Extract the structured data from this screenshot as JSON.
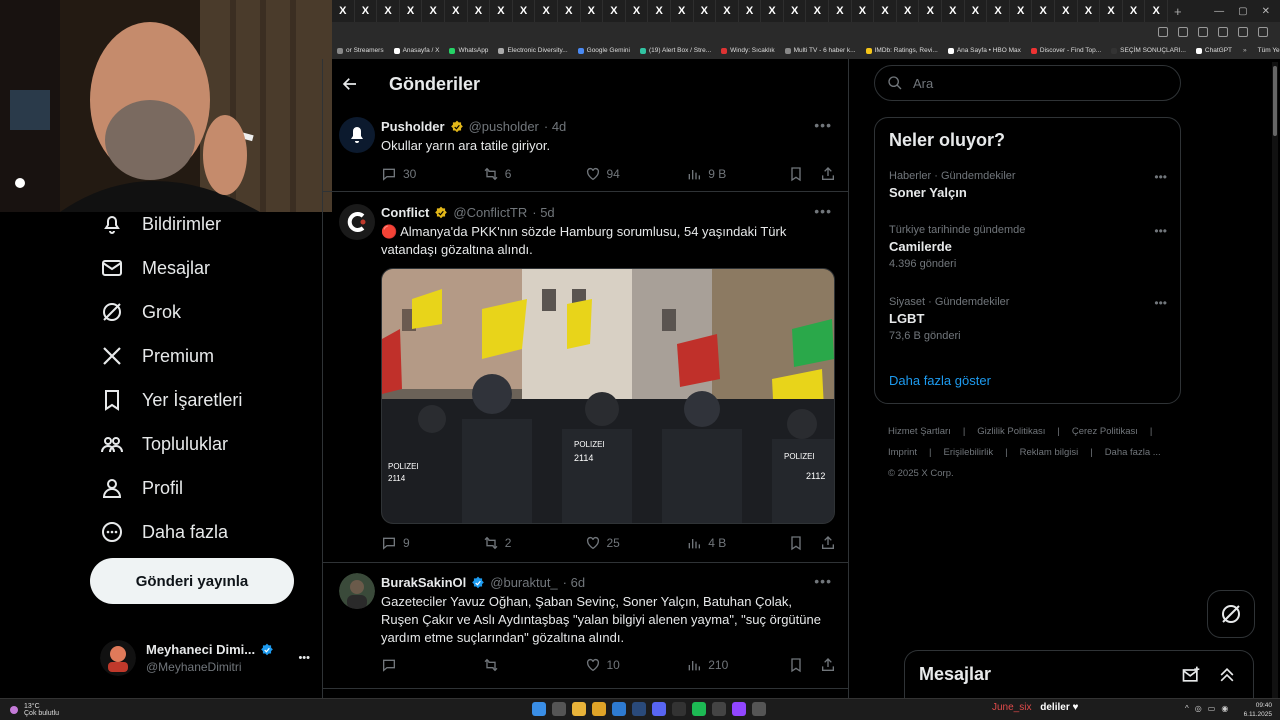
{
  "browser": {
    "tab_glyph": "X",
    "tab_count": 37,
    "new_tab": "+",
    "window_controls": [
      "—",
      "▢",
      "✕"
    ],
    "bookmarks": [
      {
        "label": "or Streamers",
        "color": "#888"
      },
      {
        "label": "Anasayfa / X",
        "color": "#ffffff"
      },
      {
        "label": "WhatsApp",
        "color": "#25d366"
      },
      {
        "label": "Electronic Diversity...",
        "color": "#aaaaaa"
      },
      {
        "label": "Google Gemini",
        "color": "#4a8af4"
      },
      {
        "label": "(19) Alert Box / Stre...",
        "color": "#31c3a2"
      },
      {
        "label": "Windy: Sıcaklık",
        "color": "#d33"
      },
      {
        "label": "Multi TV - 6 haber k...",
        "color": "#888"
      },
      {
        "label": "IMDb: Ratings, Revi...",
        "color": "#f5c518"
      },
      {
        "label": "Ana Sayfa • HBO Max",
        "color": "#ffffff"
      },
      {
        "label": "Discover - Find Top...",
        "color": "#e33"
      },
      {
        "label": "SEÇİM SONUÇLARI...",
        "color": "#333"
      },
      {
        "label": "ChatGPT",
        "color": "#ffffff"
      }
    ],
    "bookmarks_more": "»",
    "all_bookmarks": "Tüm Yer İşaretleri"
  },
  "nav": {
    "items": [
      {
        "label": "Bildirimler",
        "icon": "bell-icon"
      },
      {
        "label": "Mesajlar",
        "icon": "mail-icon"
      },
      {
        "label": "Grok",
        "icon": "grok-icon"
      },
      {
        "label": "Premium",
        "icon": "x-logo-icon"
      },
      {
        "label": "Yer İşaretleri",
        "icon": "bookmark-icon"
      },
      {
        "label": "Topluluklar",
        "icon": "communities-icon"
      },
      {
        "label": "Profil",
        "icon": "profile-icon"
      },
      {
        "label": "Daha fazla",
        "icon": "more-circle-icon"
      }
    ],
    "post_button": "Gönderi yayınla",
    "account": {
      "name": "Meyhaneci Dimi...",
      "handle": "@MeyhaneDimitri",
      "more": "•••"
    }
  },
  "main": {
    "title": "Gönderiler",
    "posts": [
      {
        "name": "Pusholder",
        "handle": "@pusholder",
        "time": "· 4d",
        "text": "Okullar yarın ara tatile giriyor.",
        "replies": "30",
        "reposts": "6",
        "likes": "94",
        "views": "9 B",
        "avatar_color": "#0c1a2e"
      },
      {
        "name": "Conflict",
        "handle": "@ConflictTR",
        "time": "· 5d",
        "text": "🔴 Almanya'da PKK'nın sözde Hamburg sorumlusu, 54 yaşındaki Türk vatandaşı gözaltına alındı.",
        "replies": "9",
        "reposts": "2",
        "likes": "25",
        "views": "4 B",
        "avatar_color": "#1a1a1a",
        "image_alt": "Police line in front of a protest crowd with flags",
        "image_text": [
          "POLIZEI",
          "2114",
          "POLIZEI",
          "2114",
          "POLIZEI",
          "2112"
        ]
      },
      {
        "name": "BurakSakinOl",
        "handle": "@buraktut_",
        "time": "· 6d",
        "text": "Gazeteciler Yavuz Oğhan, Şaban Sevinç, Soner Yalçın, Batuhan Çolak, Ruşen Çakır ve Aslı Aydıntaşbaş \"yalan bilgiyi alenen yayma\", \"suç örgütüne yardım etme suçlarından\" gözaltına alındı.",
        "replies": "",
        "reposts": "",
        "likes": "10",
        "views": "210",
        "avatar_color": "#3a4a3a"
      }
    ],
    "more": "•••"
  },
  "right": {
    "search_placeholder": "Ara",
    "trends_title": "Neler oluyor?",
    "trends": [
      {
        "category": "Haberler · Gündemdekiler",
        "name": "Soner Yalçın",
        "count": ""
      },
      {
        "category": "Türkiye tarihinde gündemde",
        "name": "Camilerde",
        "count": "4.396 gönderi"
      },
      {
        "category": "Siyaset · Gündemdekiler",
        "name": "LGBT",
        "count": "73,6 B gönderi"
      }
    ],
    "show_more": "Daha fazla göster",
    "footer": [
      "Hizmet Şartları",
      "|",
      "Gizlilik Politikası",
      "|",
      "Çerez Politikası",
      "|",
      "Imprint",
      "|",
      "Erişilebilirlik",
      "|",
      "Reklam bilgisi",
      "|",
      "Daha fazla ...",
      "© 2025 X Corp."
    ]
  },
  "messages": {
    "title": "Mesajlar"
  },
  "taskbar": {
    "temp": "13°C",
    "weather": "Çok bulutlu",
    "chat_user": "June_six",
    "chat_text": "deliler ♥",
    "time": "09:40",
    "date": "6.11.2025"
  },
  "colors": {
    "accent": "#1d9bf0",
    "verified": "#1d9bf0",
    "gold_badge": "#e2b719",
    "bg": "#000000",
    "border": "#2f3336"
  }
}
